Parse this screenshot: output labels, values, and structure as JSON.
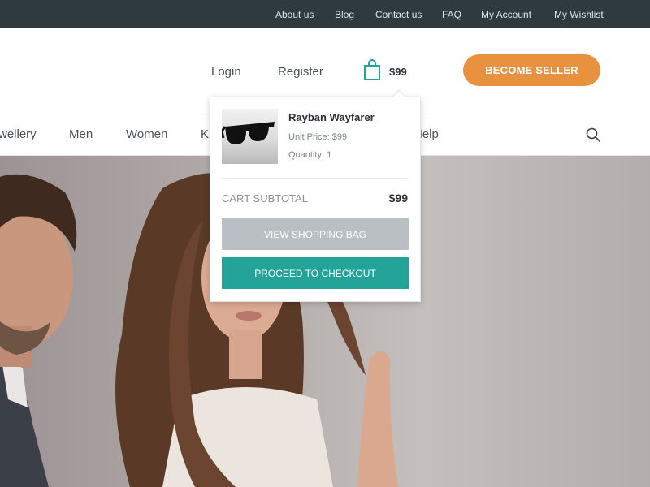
{
  "topbar": {
    "links": [
      "About us",
      "Blog",
      "Contact us",
      "FAQ",
      "My Account",
      "My Wishlist"
    ]
  },
  "header": {
    "login": "Login",
    "register": "Register",
    "cart_icon": "shopping-bag-icon",
    "cart_total": "$99",
    "seller_button": "BECOME SELLER"
  },
  "nav": {
    "categories": [
      "wellery",
      "Men",
      "Women",
      "Ki",
      "Help"
    ],
    "search_icon": "search-icon"
  },
  "cart_dropdown": {
    "item": {
      "name": "Rayban Wayfarer",
      "unit_price": "Unit Price: $99",
      "quantity": "Quantity: 1"
    },
    "subtotal_label": "CART SUBTOTAL",
    "subtotal_value": "$99",
    "view_bag_button": "VIEW SHOPPING BAG",
    "checkout_button": "PROCEED TO CHECKOUT"
  },
  "colors": {
    "topbar": "#2e3a40",
    "accent_orange": "#e8923f",
    "accent_teal": "#24a399",
    "muted_button": "#b9bfc2"
  }
}
